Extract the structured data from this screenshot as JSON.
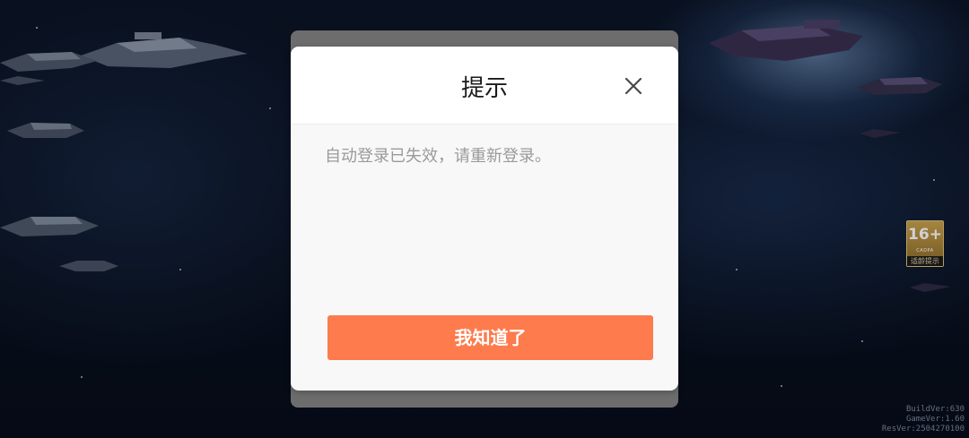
{
  "dialog": {
    "title": "提示",
    "message": "自动登录已失效，请重新登录。",
    "confirm_label": "我知道了",
    "close_icon": "close-icon",
    "accent_color": "#fd7b4d"
  },
  "age_rating": {
    "label": "16+",
    "sub_label": "CADPA",
    "tip": "适龄提示"
  },
  "version_info": {
    "build": "BuildVer:630",
    "game": "GameVer:1.60",
    "res": "ResVer:2504270100"
  }
}
